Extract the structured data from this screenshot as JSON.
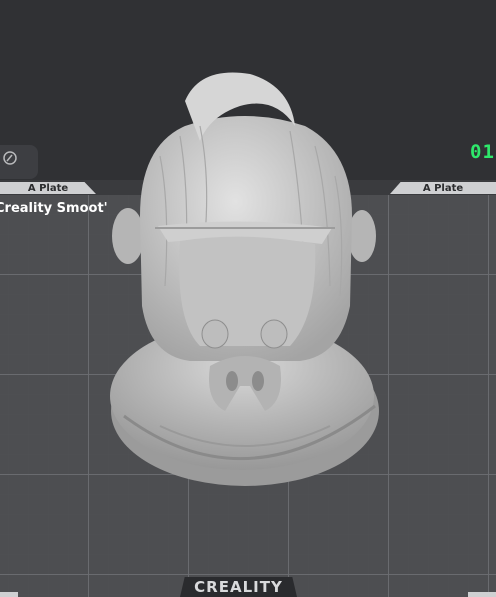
{
  "viewport": {
    "plate_tab_left": "A Plate",
    "plate_tab_right": "A Plate",
    "plate_name": "Creality Smoot'",
    "counter_text": "01",
    "brand_logo": "CREALITY"
  },
  "colors": {
    "background": "#303134",
    "bed": "#4d4e51",
    "model": "#c9c9c9",
    "counter": "#2ee86b"
  },
  "icons": {
    "corner": "edit-icon"
  }
}
